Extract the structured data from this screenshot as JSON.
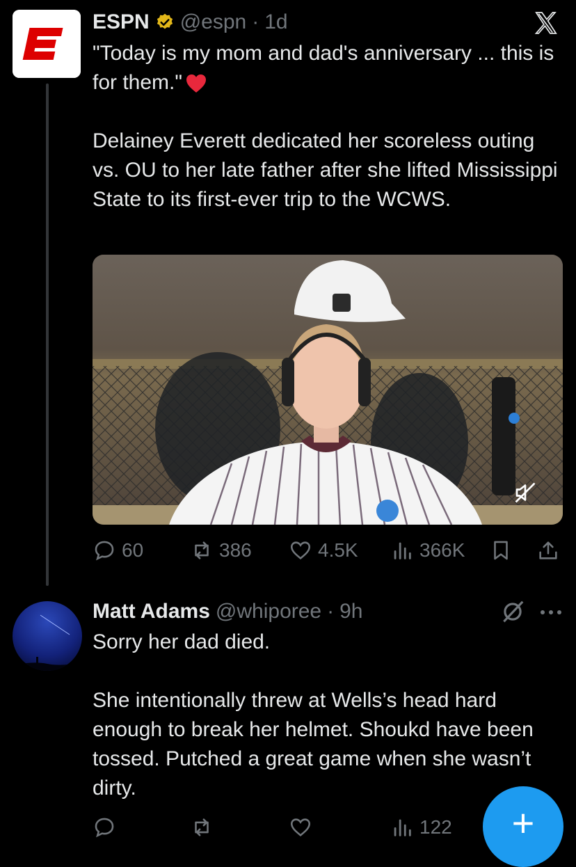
{
  "tweet1": {
    "author_name": "ESPN",
    "handle": "@espn",
    "dot": "·",
    "time": "1d",
    "text": "\"Today is my mom and dad's anniversary ... this is for them.\"",
    "text2": "Delainey Everett dedicated her scoreless outing vs. OU to her late father after she lifted Mississippi State to its first-ever trip to the WCWS.",
    "media": {
      "icon": "mute-icon"
    },
    "actions": {
      "replies": "60",
      "reposts": "386",
      "likes": "4.5K",
      "views": "366K"
    }
  },
  "tweet2": {
    "author_name": "Matt Adams",
    "handle": "@whiporee",
    "dot": "·",
    "time": "9h",
    "text": "Sorry her dad died.\n\nShe intentionally threw at Wells’s head hard enough to break her helmet. Shoukd have been tossed. Putched a great game when she wasn’t dirty.",
    "actions": {
      "views": "122"
    }
  },
  "fab": {
    "label": "+"
  },
  "colors": {
    "accent": "#1d9bf0",
    "verified": "#e2b719",
    "muted": "#71767b",
    "espn_red": "#d00"
  }
}
